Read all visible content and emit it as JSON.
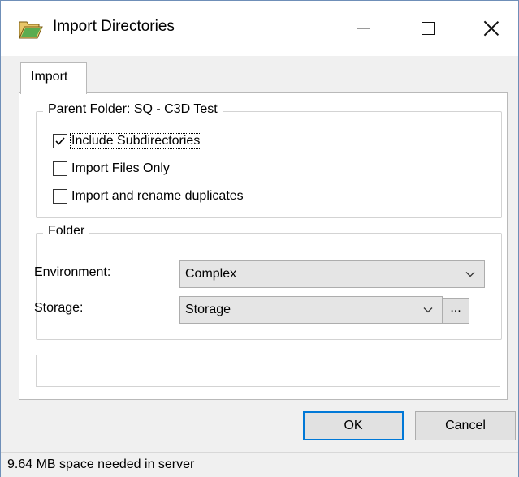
{
  "window": {
    "title": "Import Directories"
  },
  "tabs": [
    {
      "label": "Import"
    }
  ],
  "parent_group": {
    "title": "Parent Folder: SQ - C3D Test",
    "options": [
      {
        "label": "Include Subdirectories",
        "checked": true
      },
      {
        "label": "Import Files Only",
        "checked": false
      },
      {
        "label": "Import and rename duplicates",
        "checked": false
      }
    ]
  },
  "folder_group": {
    "title": "Folder",
    "environment_label": "Environment:",
    "environment_value": "Complex",
    "storage_label": "Storage:",
    "storage_value": "Storage",
    "browse_label": "..."
  },
  "buttons": {
    "ok": "OK",
    "cancel": "Cancel"
  },
  "status": {
    "text": "9.64 MB space needed in server"
  },
  "colors": {
    "accent": "#0078d7",
    "window_border": "#6f8fb8"
  },
  "icons": [
    "folder-icon",
    "minimize-icon",
    "maximize-icon",
    "close-icon",
    "checkmark-icon",
    "chevron-down-icon"
  ]
}
